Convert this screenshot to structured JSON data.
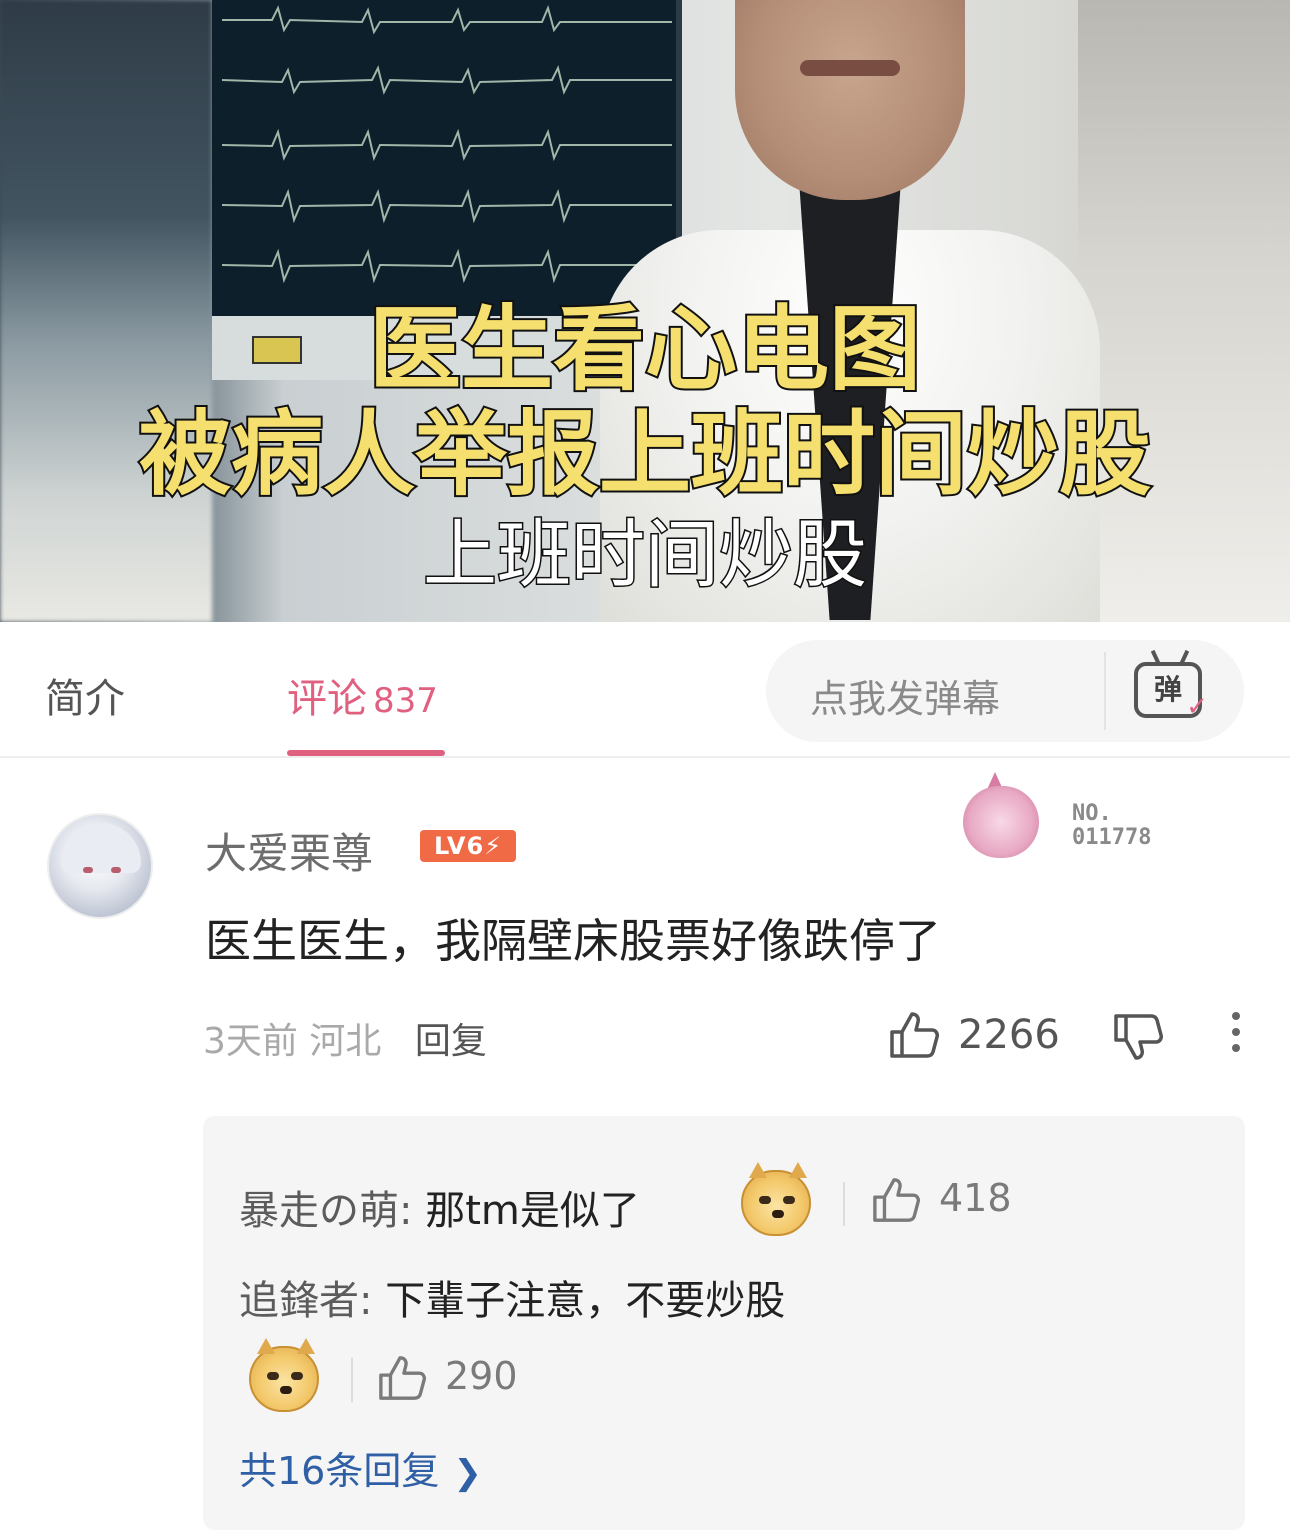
{
  "video": {
    "caption_line1": "医生看心电图",
    "caption_line2": "被病人举报上班时间炒股",
    "subtitle": "上班时间炒股"
  },
  "tabs": {
    "intro_label": "简介",
    "comments_label": "评论",
    "comments_count": "837",
    "danmaku_placeholder": "点我发弹幕",
    "danmaku_icon_text": "弹"
  },
  "comment": {
    "username": "大爱栗尊",
    "level": "LV6⚡",
    "fan_no_label": "NO.",
    "fan_no_value": "011778",
    "text": "医生医生，我隔壁床股票好像跌停了",
    "time": "3天前",
    "location": "河北",
    "reply_label": "回复",
    "likes": "2266"
  },
  "replies": [
    {
      "name": "暴走の萌:",
      "text": "那tm是似了",
      "likes": "418"
    },
    {
      "name": "追鋒者:",
      "text": "下輩子注意，不要炒股",
      "likes": "290"
    }
  ],
  "more_replies": "共16条回复",
  "colors": {
    "accent": "#e0607f",
    "level_badge": "#f06a45",
    "link": "#2f5fa5",
    "caption_yellow": "#f5df6f"
  },
  "icons": [
    "danmaku-icon",
    "thumb-up-icon",
    "thumb-down-icon",
    "more-vertical-icon",
    "doge-emoji-icon",
    "chevron-right-icon"
  ]
}
